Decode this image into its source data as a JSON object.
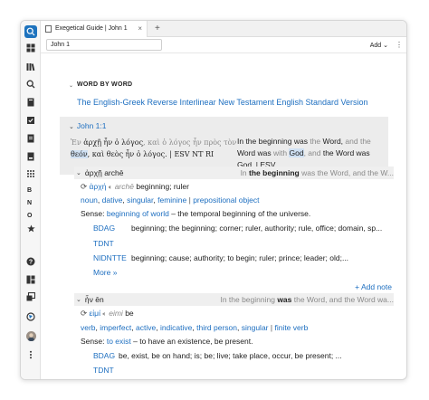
{
  "sidebar": {
    "icons": [
      "search-icon",
      "dashboard-icon",
      "library-icon",
      "magnifier-icon",
      "notes-icon",
      "checklist-icon",
      "document-icon",
      "page-icon",
      "apps-icon"
    ],
    "letters": [
      "B",
      "N",
      "O"
    ],
    "bottom_icons": [
      "help-icon",
      "layout-icon",
      "window-icon",
      "sync-icon",
      "avatar",
      "more-icon"
    ]
  },
  "tab": {
    "label": "Exegetical Guide | John 1",
    "close": "×",
    "new": "+"
  },
  "refbar": {
    "reference": "John 1",
    "add_label": "Add",
    "menu": "⋮"
  },
  "section": {
    "label": "WORD BY WORD"
  },
  "resource_title": "The English-Greek Reverse Interlinear New Testament English Standard Version",
  "verse": {
    "ref": "John 1:1",
    "greek": [
      {
        "t": "Ἐν ",
        "c": "grey"
      },
      {
        "t": "ἀρχῇ ἦν ὁ λόγος",
        "c": ""
      },
      {
        "t": ", καὶ ὁ λόγος ἦν πρὸς",
        "c": "grey"
      },
      {
        "t": " τὸν ",
        "c": "grey"
      },
      {
        "t": "θεόν",
        "c": "hl"
      },
      {
        "t": ", καὶ θεὸς ἦν ὁ λόγος",
        "c": ""
      },
      {
        "t": ". | ESV NT RI",
        "c": ""
      }
    ],
    "english": [
      {
        "t": "In the beginning was ",
        "c": ""
      },
      {
        "t": "the ",
        "c": "grey"
      },
      {
        "t": "Word, ",
        "c": ""
      },
      {
        "t": "and the",
        "c": "grey"
      },
      {
        "t": " Word was ",
        "c": ""
      },
      {
        "t": "with ",
        "c": "grey"
      },
      {
        "t": "God",
        "c": "hl"
      },
      {
        "t": ", and ",
        "c": "grey"
      },
      {
        "t": "the Word was",
        "c": ""
      },
      {
        "t": " God. | ESV",
        "c": ""
      }
    ]
  },
  "entries": [
    {
      "greek": "ἀρχῇ",
      "translit": "archē",
      "ctx_pre": "In ",
      "ctx_bold": "the beginning",
      "ctx_post": " was the Word, and the W...",
      "lemma": "ἀρχή",
      "lemma_translit": "archē",
      "gloss": "beginning; ruler",
      "morph": [
        "noun",
        "dative",
        "singular",
        "feminine"
      ],
      "morph_extra": "prepositional object",
      "sense_label": "Sense:",
      "sense_link": "beginning of world",
      "sense_text": " – the temporal beginning of the universe.",
      "lexicons": [
        {
          "name": "BDAG",
          "text": "beginning; the beginning; corner; ruler, authority; rule, office; domain, sp..."
        },
        {
          "name": "TDNT",
          "text": ""
        },
        {
          "name": "NIDNTTE",
          "text": "beginning; cause; authority; to begin; ruler; prince; leader; old;..."
        }
      ],
      "more": "More »",
      "add_note": "+ Add note"
    },
    {
      "greek": "ἦν",
      "translit": "ēn",
      "ctx_pre": "In the beginning ",
      "ctx_bold": "was",
      "ctx_post": " the Word, and the Word wa...",
      "lemma": "εἰμί",
      "lemma_translit": "eimi",
      "gloss": "be",
      "morph": [
        "verb",
        "imperfect",
        "active",
        "indicative",
        "third person",
        "singular"
      ],
      "morph_extra": "finite verb",
      "sense_label": "Sense:",
      "sense_link": "to exist",
      "sense_text": " – to have an existence, be present.",
      "lexicons": [
        {
          "name": "BDAG",
          "text": "be, exist, be on hand; is; be; live; take place, occur, be present; ..."
        },
        {
          "name": "TDNT",
          "text": ""
        }
      ]
    }
  ]
}
